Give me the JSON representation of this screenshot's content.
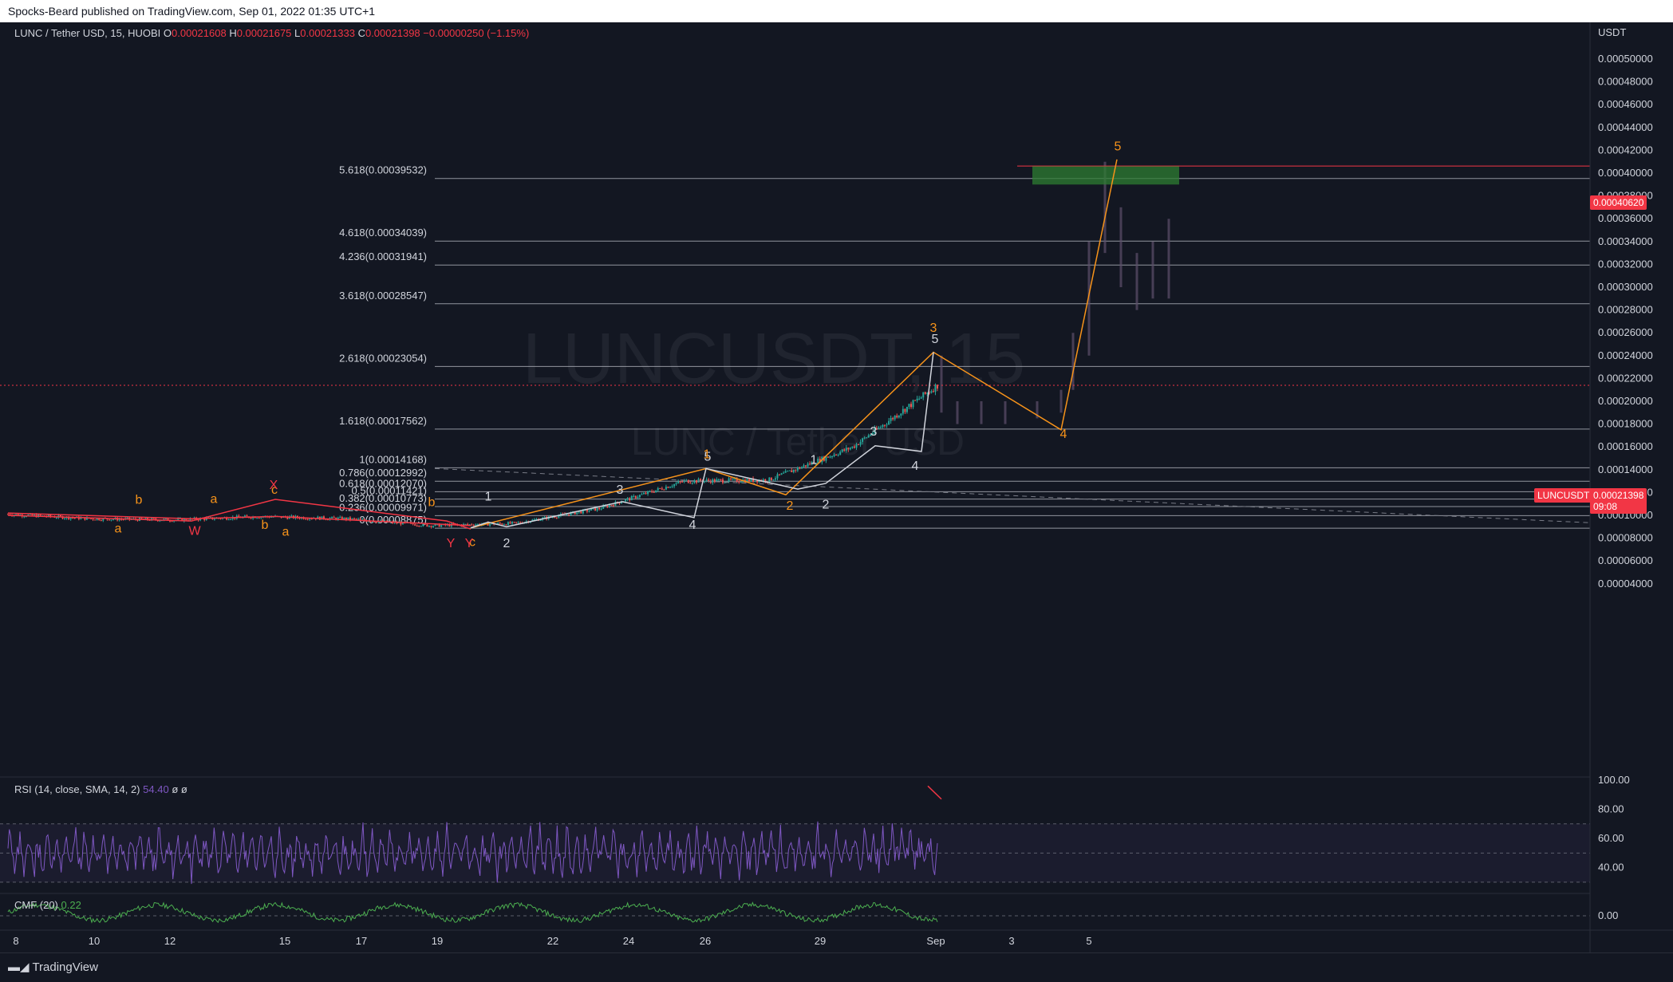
{
  "publisher": "Spocks-Beard published on TradingView.com, Sep 01, 2022 01:35 UTC+1",
  "watermark": {
    "symbol": "LUNCUSDT, 15",
    "description": "LUNC / Tether USD"
  },
  "legend": {
    "symbol": "LUNC / Tether USD, 15, HUOBI",
    "open_label": "O",
    "open": "0.00021608",
    "high_label": "H",
    "high": "0.00021675",
    "low_label": "L",
    "low": "0.00021333",
    "close_label": "C",
    "close": "0.00021398",
    "change": "−0.00000250 (−1.15%)"
  },
  "price_axis": {
    "unit": "USDT",
    "ticks": [
      "0.00050000",
      "0.00048000",
      "0.00046000",
      "0.00044000",
      "0.00042000",
      "0.00040000",
      "0.00038000",
      "0.00036000",
      "0.00034000",
      "0.00032000",
      "0.00030000",
      "0.00028000",
      "0.00026000",
      "0.00024000",
      "0.00022000",
      "0.00020000",
      "0.00018000",
      "0.00016000",
      "0.00014000",
      "0.00012000",
      "0.00010000",
      "0.00008000",
      "0.00006000",
      "0.00004000"
    ],
    "alert_price": "0.00040620",
    "last_price": "0.00021398",
    "countdown": "09:08",
    "symbol_tag": "LUNCUSDT"
  },
  "time_axis": {
    "ticks": [
      "8",
      "10",
      "12",
      "15",
      "17",
      "19",
      "22",
      "24",
      "26",
      "29",
      "Sep",
      "3",
      "5"
    ]
  },
  "fib_levels": [
    {
      "label": "5.618(0.00039532)"
    },
    {
      "label": "4.618(0.00034039)"
    },
    {
      "label": "4.236(0.00031941)"
    },
    {
      "label": "3.618(0.00028547)"
    },
    {
      "label": "2.618(0.00023054)"
    },
    {
      "label": "1.618(0.00017562)"
    },
    {
      "label": "1(0.00014168)"
    },
    {
      "label": "0.786(0.00012992)"
    },
    {
      "label": "0.618(0.00012070)"
    },
    {
      "label": "0.5(0.00011421)"
    },
    {
      "label": "0.382(0.00010773)"
    },
    {
      "label": "0.236(0.00009971)"
    },
    {
      "label": "0(0.00008875)"
    }
  ],
  "wave_labels": {
    "white": [
      "1",
      "2",
      "3",
      "4",
      "5",
      "1",
      "2",
      "3",
      "4",
      "5"
    ],
    "orange": [
      "a",
      "b",
      "a",
      "c",
      "b",
      "a",
      "b",
      "c",
      "3",
      "2",
      "4",
      "5",
      "1"
    ],
    "red": [
      "X",
      "W",
      "Y",
      "Y"
    ]
  },
  "rsi": {
    "label": "RSI (14, close, SMA, 14, 2)",
    "value": "54.40",
    "extras": "ø ø",
    "ticks": [
      "100.00",
      "80.00",
      "60.00",
      "40.00"
    ]
  },
  "cmf": {
    "label": "CMF (20)",
    "value": "0.22",
    "ticks": [
      "0.00"
    ]
  },
  "footer_brand": "TradingView",
  "colors": {
    "background": "#131722",
    "up": "#26a69a",
    "down": "#ef5350",
    "orange": "#f7931a",
    "red": "#f23645",
    "rsi": "#7e57c2",
    "cmf": "#4caf50",
    "target_box": "#2e7d32"
  },
  "chart_data": {
    "type": "candlestick",
    "symbol": "LUNC / Tether USD",
    "timeframe": "15",
    "ylim": [
      3e-05,
      0.00052
    ],
    "x_ticks": [
      "8",
      "10",
      "12",
      "15",
      "17",
      "19",
      "22",
      "24",
      "26",
      "29",
      "Sep",
      "3",
      "5"
    ],
    "price_path": [
      {
        "x": "8",
        "y": 0.000101
      },
      {
        "x": "10",
        "y": 9.7e-05
      },
      {
        "x": "12",
        "y": 9.6e-05
      },
      {
        "x": "15",
        "y": 9.9e-05
      },
      {
        "x": "17",
        "y": 9.7e-05
      },
      {
        "x": "19",
        "y": 9.1e-05
      },
      {
        "x": "22",
        "y": 9.3e-05
      },
      {
        "x": "24",
        "y": 0.000106
      },
      {
        "x": "26",
        "y": 0.00013
      },
      {
        "x": "29",
        "y": 0.000131
      },
      {
        "x": "31",
        "y": 0.00016
      },
      {
        "x": "Sep",
        "y": 0.000214
      }
    ],
    "fib_levels": [
      0.00039532,
      0.00034039,
      0.00031941,
      0.00028547,
      0.00023054,
      0.00017562,
      0.00014168,
      0.00012992,
      0.0001207,
      0.00011421,
      0.00010773,
      9.971e-05,
      8.875e-05
    ],
    "projection": {
      "wave3": 0.000243,
      "wave4": 0.000175,
      "wave5": 0.000412
    },
    "target_zone": [
      0.00039,
      0.000406
    ],
    "last_price": 0.00021398,
    "rsi_last": 54.4,
    "cmf_last": 0.22
  }
}
